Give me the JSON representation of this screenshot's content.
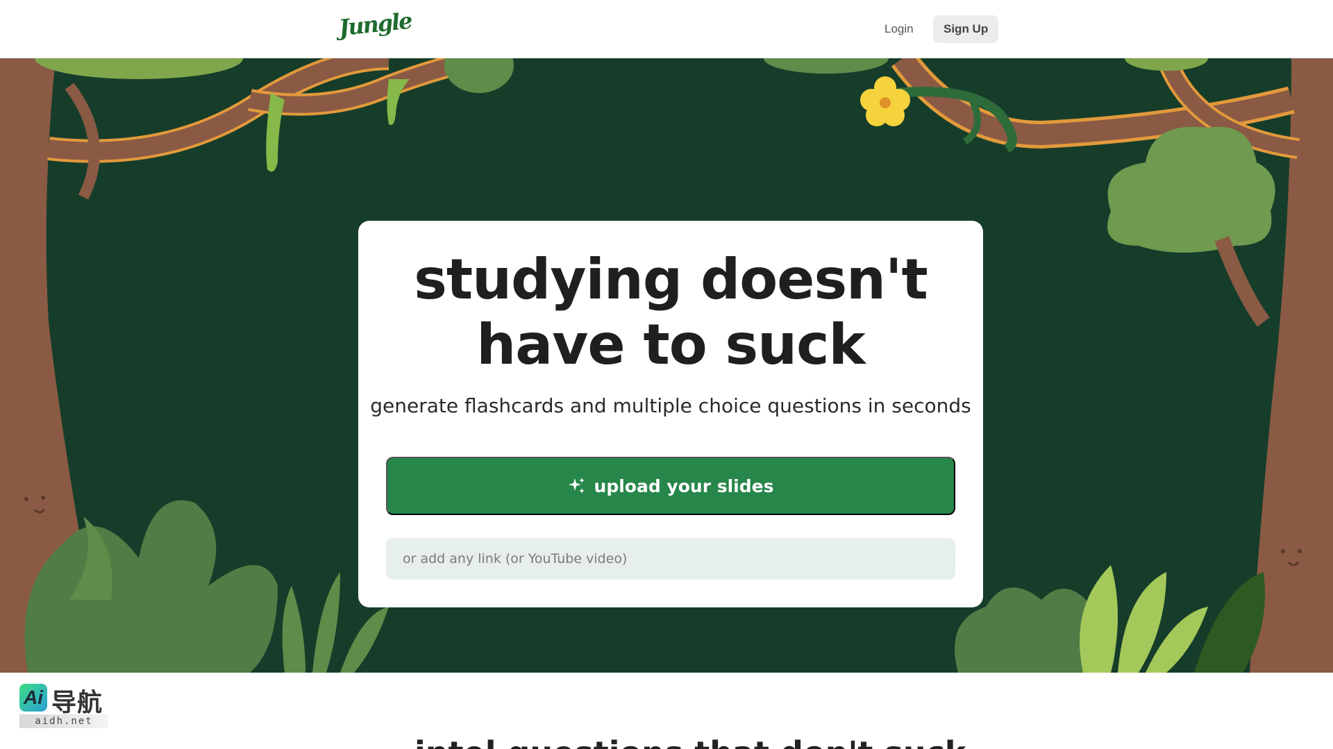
{
  "navbar": {
    "logo_text": "Jungle",
    "login_label": "Login",
    "signup_label": "Sign Up"
  },
  "hero": {
    "headline_line1": "studying doesn't",
    "headline_line2": "have to suck",
    "subheadline": "generate flashcards and multiple choice questions in seconds",
    "upload_button_label": "upload your slides",
    "upload_icon": "sparkle-icon",
    "link_input": {
      "placeholder": "or add any link (or YouTube video)",
      "value": ""
    }
  },
  "watermark": {
    "badge": "Ai",
    "title": "导航",
    "domain": "aidh.net"
  },
  "next_section": {
    "heading_partial": "... intel questions that don't suck"
  },
  "colors": {
    "hero_bg": "#163d2a",
    "primary_button": "#27864a",
    "input_bg": "#e7efea",
    "tree_trunk": "#8a5a44",
    "leaf_light": "#7fa64a",
    "leaf_mid": "#4f7d45",
    "flower": "#f6d23c"
  }
}
